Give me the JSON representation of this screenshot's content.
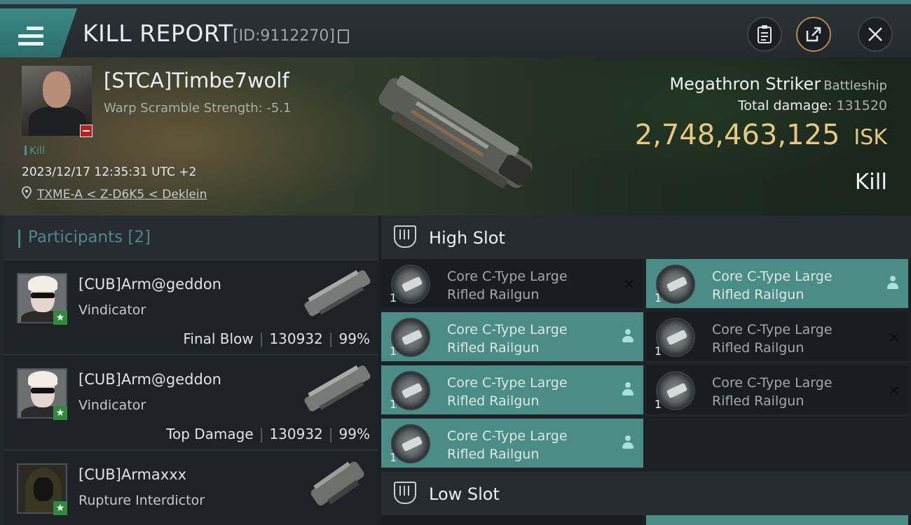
{
  "header": {
    "title": "KILL REPORT",
    "report_id": "[ID:9112270]"
  },
  "victim": {
    "pilot_name": "[STCA]Timbe7wolf",
    "warp_scramble": "Warp Scramble Strength: -5.1",
    "kill_tag": "Kill",
    "timestamp": "2023/12/17 12:35:31 UTC +2",
    "location": "TXME-A < Z-D6K5 < Deklein",
    "ship_name": "Megathron Striker",
    "ship_class": "Battleship",
    "total_damage_label": "Total damage:",
    "total_damage_value": "131520",
    "isk_value": "2,748,463,125",
    "isk_unit": "ISK",
    "result_label": "Kill"
  },
  "participants": {
    "title": "Participants [2]",
    "rows": [
      {
        "name": "[CUB]Arm@geddon",
        "ship": "Vindicator",
        "role": "Final Blow",
        "damage": "130932",
        "percent": "99%"
      },
      {
        "name": "[CUB]Arm@geddon",
        "ship": "Vindicator",
        "role": "Top Damage",
        "damage": "130932",
        "percent": "99%"
      },
      {
        "name": "[CUB]Armaxxx",
        "ship": "Rupture Interdictor"
      }
    ]
  },
  "slots": {
    "high_title": "High Slot",
    "low_title": "Low Slot",
    "modules": [
      {
        "line1": "Core C-Type Large",
        "line2": "Rifled Railgun",
        "qty": "1",
        "status": "destroyed"
      },
      {
        "line1": "Core C-Type Large",
        "line2": "Rifled Railgun",
        "qty": "1",
        "status": "dropped"
      },
      {
        "line1": "Core C-Type Large",
        "line2": "Rifled Railgun",
        "qty": "1",
        "status": "dropped"
      },
      {
        "line1": "Core C-Type Large",
        "line2": "Rifled Railgun",
        "qty": "1",
        "status": "destroyed"
      },
      {
        "line1": "Core C-Type Large",
        "line2": "Rifled Railgun",
        "qty": "1",
        "status": "dropped"
      },
      {
        "line1": "Core C-Type Large",
        "line2": "Rifled Railgun",
        "qty": "1",
        "status": "destroyed"
      },
      {
        "line1": "Core C-Type Large",
        "line2": "Rifled Railgun",
        "qty": "1",
        "status": "dropped"
      }
    ]
  },
  "icons": {
    "menu": "menu-icon",
    "clipboard": "clipboard-icon",
    "share": "share-icon",
    "close": "close-icon",
    "location": "location-pin-icon",
    "slot": "slot-icon",
    "dropped": "person-icon",
    "destroyed": "x-icon"
  },
  "colors": {
    "accent": "#3d7d7f",
    "isk": "#e6c880",
    "dropped_bg": "#4a8c86",
    "star": "#2e8b3e"
  }
}
